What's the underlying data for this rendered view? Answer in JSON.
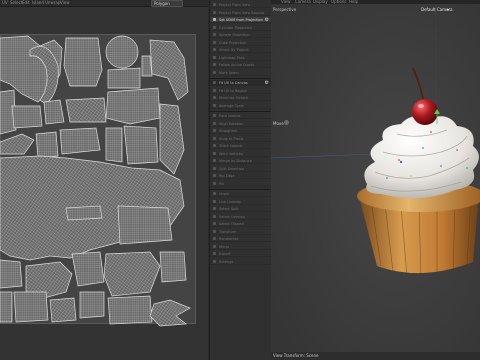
{
  "uv_editor": {
    "menu": [
      "UV",
      "Select",
      "Edit",
      "Island",
      "Unwrap",
      "View"
    ],
    "dropdown_value": "Polygon"
  },
  "tool_panel": {
    "items": [
      {
        "label": "Project From View",
        "state": "normal"
      },
      {
        "label": "Project From View Bounds",
        "state": "normal"
      },
      {
        "label": "Set UDIM from Projection",
        "state": "active"
      },
      {
        "label": "Cylinder Projection",
        "state": "normal"
      },
      {
        "label": "Sphere Projection",
        "state": "normal"
      },
      {
        "label": "Cube Projection",
        "state": "normal"
      },
      {
        "label": "Smart UV Project",
        "state": "normal"
      },
      {
        "label": "Lightmap Pack",
        "state": "normal"
      },
      {
        "label": "Follow Active Quads",
        "state": "normal"
      },
      {
        "label": "Mark Seam",
        "state": "normal"
      },
      {
        "label": "Fit UV to Canvas",
        "state": "header"
      },
      {
        "label": "Fit UV to Region",
        "state": "normal"
      },
      {
        "label": "Minimize Stretch",
        "state": "normal"
      },
      {
        "label": "Average Scale",
        "state": "normal"
      },
      {
        "label": "Pack Islands",
        "state": "normal"
      },
      {
        "label": "Align Rotation",
        "state": "normal"
      },
      {
        "label": "Straighten",
        "state": "normal"
      },
      {
        "label": "Snap to Pixels",
        "state": "normal"
      },
      {
        "label": "Stitch Islands",
        "state": "normal"
      },
      {
        "label": "Weld Vertices",
        "state": "normal"
      },
      {
        "label": "Merge by Distance",
        "state": "normal"
      },
      {
        "label": "Split Selection",
        "state": "normal"
      },
      {
        "label": "Rip Edge",
        "state": "normal"
      },
      {
        "label": "Pin",
        "state": "normal"
      },
      {
        "label": "Unpin",
        "state": "normal"
      },
      {
        "label": "Live Unwrap",
        "state": "normal"
      },
      {
        "label": "Select Split",
        "state": "normal"
      },
      {
        "label": "Select Overlap",
        "state": "normal"
      },
      {
        "label": "Select Flipped",
        "state": "normal"
      },
      {
        "label": "Transform",
        "state": "normal"
      },
      {
        "label": "Randomize",
        "state": "normal"
      },
      {
        "label": "Mirror",
        "state": "normal"
      },
      {
        "label": "Export",
        "state": "normal"
      },
      {
        "label": "Settings",
        "state": "normal"
      }
    ]
  },
  "viewport": {
    "menu": [
      "View",
      "Camera",
      "Display",
      "Options",
      "Help"
    ],
    "label": "Perspective",
    "camera": "Default Camera",
    "camera_arrow": "▾",
    "move_label": "Move",
    "status": "View Transform: Scene"
  },
  "colors": {
    "active_row": "#3d3d3d",
    "cupcake_frosting": "#e8e6e2",
    "cherry": "#b01a22",
    "cake": "#c98a3e"
  },
  "icons": {
    "gear": "gear-icon",
    "dropdown": "chevron-down-icon"
  }
}
